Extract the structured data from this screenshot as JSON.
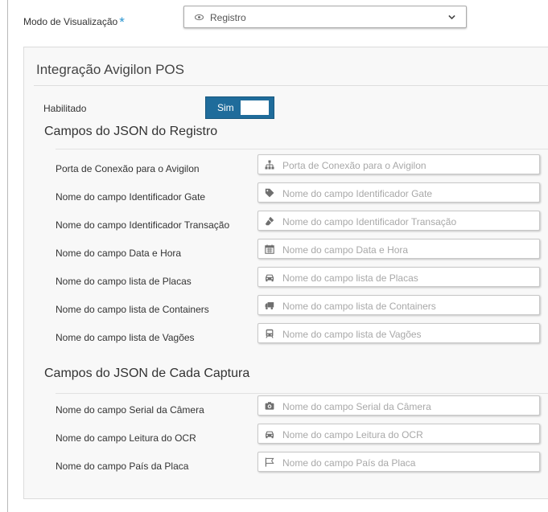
{
  "view_mode": {
    "label": "Modo de Visualização",
    "required_mark": "*",
    "selected": "Registro"
  },
  "panel": {
    "title": "Integração Avigilon POS",
    "enabled": {
      "label": "Habilitado",
      "toggle_text": "Sim"
    }
  },
  "registro_section": {
    "title": "Campos do JSON do Registro",
    "fields": [
      {
        "label": "Porta de Conexão para o Avigilon",
        "placeholder": "Porta de Conexão para o Avigilon",
        "icon": "sitemap-icon"
      },
      {
        "label": "Nome do campo Identificador Gate",
        "placeholder": "Nome do campo Identificador Gate",
        "icon": "tag-icon"
      },
      {
        "label": "Nome do campo Identificador Transação",
        "placeholder": "Nome do campo Identificador Transação",
        "icon": "eraser-icon"
      },
      {
        "label": "Nome do campo Data e Hora",
        "placeholder": "Nome do campo Data e Hora",
        "icon": "calendar-icon"
      },
      {
        "label": "Nome do campo lista de Placas",
        "placeholder": "Nome do campo lista de Placas",
        "icon": "car-icon"
      },
      {
        "label": "Nome do campo lista de Containers",
        "placeholder": "Nome do campo lista de Containers",
        "icon": "truck-icon"
      },
      {
        "label": "Nome do campo lista de Vagões",
        "placeholder": "Nome do campo lista de Vagões",
        "icon": "train-icon"
      }
    ]
  },
  "captura_section": {
    "title": "Campos do JSON de Cada Captura",
    "fields": [
      {
        "label": "Nome do campo Serial da Câmera",
        "placeholder": "Nome do campo Serial da Câmera",
        "icon": "camera-icon"
      },
      {
        "label": "Nome do campo Leitura do OCR",
        "placeholder": "Nome do campo Leitura do OCR",
        "icon": "car-icon"
      },
      {
        "label": "Nome do campo País da Placa",
        "placeholder": "Nome do campo País da Placa",
        "icon": "flag-icon"
      }
    ]
  },
  "colors": {
    "accent": "#2a95d0",
    "toggle_bg": "#1f6c9b",
    "placeholder": "#a8a8a8",
    "icon": "#6f6f6f"
  }
}
